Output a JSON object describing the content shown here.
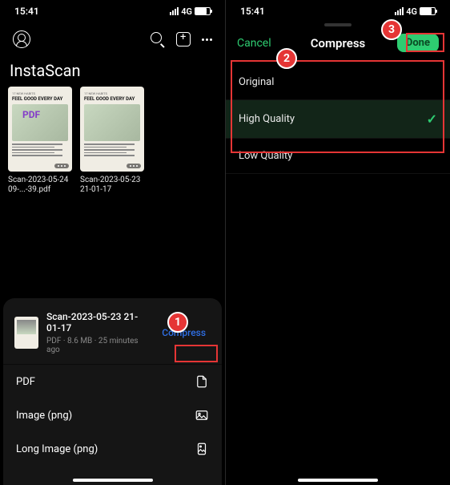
{
  "status": {
    "time": "15:41",
    "network": "4G"
  },
  "left": {
    "appTitle": "InstaScan",
    "docs": [
      {
        "pdfBadge": "PDF",
        "headline": "17 NEW HABITS",
        "bigTitle": "FEEL GOOD EVERY DAY",
        "label": "Scan-2023-05-24 09-...-39.pdf"
      },
      {
        "headline": "17 NEW HABITS",
        "bigTitle": "FEEL GOOD EVERY DAY",
        "label": "Scan-2023-05-23 21-01-17"
      }
    ],
    "sheet": {
      "filename": "Scan-2023-05-23 21-01-17",
      "meta": "PDF  ·  8.6 MB  ·  25 minutes ago",
      "compress": "Compress",
      "rows": [
        {
          "label": "PDF"
        },
        {
          "label": "Image (png)"
        },
        {
          "label": "Long Image (png)"
        }
      ]
    }
  },
  "right": {
    "cancel": "Cancel",
    "title": "Compress",
    "done": "Done",
    "options": [
      {
        "label": "Original",
        "selected": false
      },
      {
        "label": "High Quality",
        "selected": true
      },
      {
        "label": "Low Quality",
        "selected": false
      }
    ]
  },
  "callouts": {
    "one": "1",
    "two": "2",
    "three": "3"
  }
}
